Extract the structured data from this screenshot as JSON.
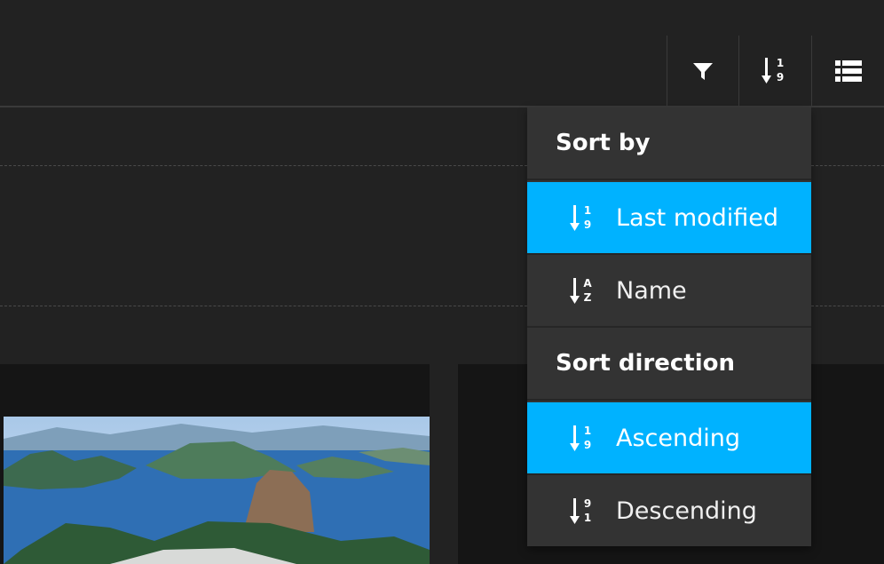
{
  "toolbar": {
    "filter_icon": "filter-icon",
    "sort_icon": "sort-numeric-asc-icon",
    "view_icon": "list-view-icon"
  },
  "sort_menu": {
    "sort_by_header": "Sort by",
    "sort_by_options": [
      {
        "label": "Last modified",
        "icon": "sort-numeric-asc-icon",
        "selected": true
      },
      {
        "label": "Name",
        "icon": "sort-alpha-asc-icon",
        "selected": false
      }
    ],
    "sort_direction_header": "Sort direction",
    "direction_options": [
      {
        "label": "Ascending",
        "icon": "sort-numeric-asc-icon",
        "selected": true
      },
      {
        "label": "Descending",
        "icon": "sort-numeric-desc-icon",
        "selected": false
      }
    ]
  },
  "colors": {
    "background": "#222222",
    "menu_background": "#333333",
    "accent": "#00b2ff",
    "card_background": "#151515"
  }
}
